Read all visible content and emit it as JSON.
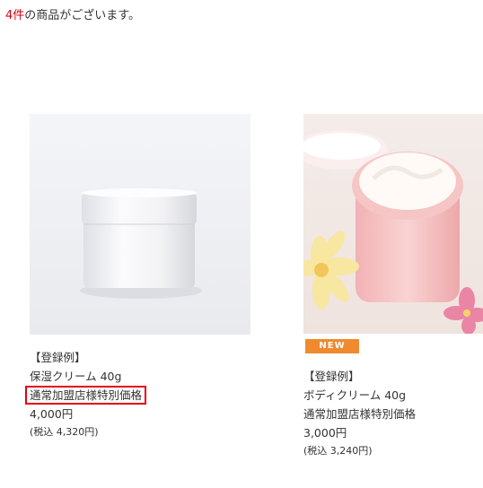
{
  "result": {
    "count": "4件",
    "suffix": "の商品がございます。"
  },
  "products": [
    {
      "tag": "【登録例】",
      "name": "保湿クリーム 40g",
      "note": "通常加盟店様特別価格",
      "price": "4,000円",
      "tax": "(税込 4,320円)",
      "badge": ""
    },
    {
      "tag": "【登録例】",
      "name": "ボディクリーム 40g",
      "note": "通常加盟店様特別価格",
      "price": "3,000円",
      "tax": "(税込 3,240円)",
      "badge": "NEW"
    }
  ],
  "colors": {
    "accent": "#d7000f",
    "highlight_border": "#e60012",
    "badge_bg": "#ef8a2f"
  }
}
